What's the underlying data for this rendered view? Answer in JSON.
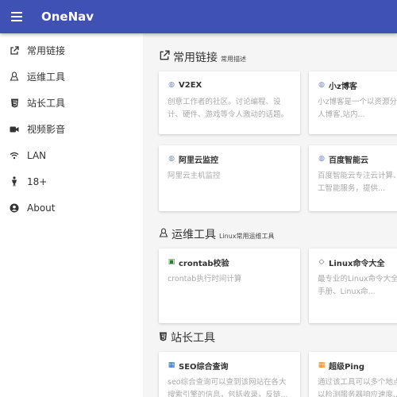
{
  "app": {
    "title": "OneNav"
  },
  "sidebar": {
    "items": [
      {
        "label": "常用链接",
        "icon": "external-link-icon"
      },
      {
        "label": "运维工具",
        "icon": "linux-icon"
      },
      {
        "label": "站长工具",
        "icon": "html5-icon"
      },
      {
        "label": "视频影音",
        "icon": "video-icon"
      },
      {
        "label": "LAN",
        "icon": "wifi-icon"
      },
      {
        "label": "18+",
        "icon": "person-icon"
      },
      {
        "label": "About",
        "icon": "user-circle-icon"
      }
    ]
  },
  "sections": [
    {
      "title": "常用链接",
      "desc": "常用描述",
      "icon": "external-link-icon",
      "cards": [
        {
          "title": "V2EX",
          "desc": "创意工作者的社区。讨论编程、设计、硬件、游戏等令人激动的话题。"
        },
        {
          "title": "小z博客",
          "desc": "小z博客是一个以资源分享为主的个人博客,站内..."
        },
        {
          "title": "阿里云监控",
          "desc": "阿里云主机监控"
        },
        {
          "title": "百度智能云",
          "desc": "百度智能云专注云计算、大数据、人工智能服务，提供..."
        }
      ]
    },
    {
      "title": "运维工具",
      "desc": "Linux常用运维工具",
      "icon": "linux-icon",
      "cards": [
        {
          "title": "crontab校验",
          "desc": "crontab执行时间计算"
        },
        {
          "title": "Linux命令大全",
          "desc": "最专业的Linux命令大全，Linux命令手册、Linux命..."
        }
      ]
    },
    {
      "title": "站长工具",
      "desc": "",
      "icon": "html5-icon",
      "cards": [
        {
          "title": "SEO综合查询",
          "desc": "seo综合查询可以查到该网站在各大搜索引擎的信息，包括收录，反链..."
        },
        {
          "title": "超级Ping",
          "desc": "通过该工具可以多个地点Ping服务器以检测服务器响应速度..."
        }
      ]
    }
  ],
  "colors": {
    "topbar": "#3f51b5",
    "background": "#f5f5f5"
  }
}
